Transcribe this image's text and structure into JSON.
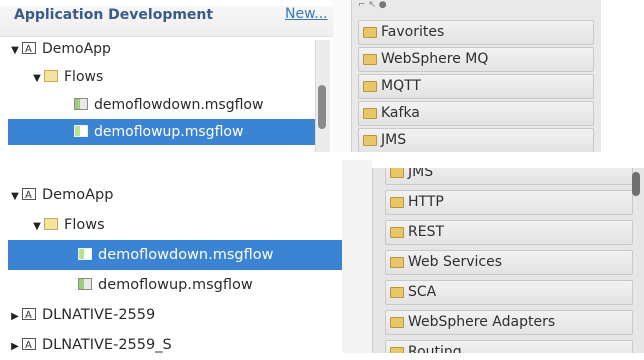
{
  "top_panel": {
    "title": "Application Development",
    "new_link": "New...",
    "tree": [
      {
        "label": "DemoApp",
        "level": 0,
        "expanded": true,
        "icon": "application-icon"
      },
      {
        "label": "Flows",
        "level": 1,
        "expanded": true,
        "icon": "folder-icon"
      },
      {
        "label": "demoflowdown.msgflow",
        "level": 2,
        "icon": "message-flow-icon",
        "selected": false
      },
      {
        "label": "demoflowup.msgflow",
        "level": 2,
        "icon": "message-flow-icon",
        "selected": true
      }
    ],
    "palette": [
      "Favorites",
      "WebSphere MQ",
      "MQTT",
      "Kafka",
      "JMS"
    ]
  },
  "bottom_panel": {
    "tree": [
      {
        "label": "DemoApp",
        "level": 0,
        "expanded": true,
        "icon": "application-icon"
      },
      {
        "label": "Flows",
        "level": 1,
        "expanded": true,
        "icon": "folder-icon"
      },
      {
        "label": "demoflowdown.msgflow",
        "level": 2,
        "icon": "message-flow-icon",
        "selected": true
      },
      {
        "label": "demoflowup.msgflow",
        "level": 2,
        "icon": "message-flow-icon",
        "selected": false
      },
      {
        "label": "DLNATIVE-2559",
        "level": 0,
        "expanded": false,
        "icon": "application-icon"
      },
      {
        "label": "DLNATIVE-2559_S",
        "level": 0,
        "expanded": false,
        "icon": "application-icon"
      }
    ],
    "palette": [
      "JMS",
      "HTTP",
      "REST",
      "Web Services",
      "SCA",
      "WebSphere Adapters",
      "Routing"
    ]
  },
  "colors": {
    "selection": "#3b83d3",
    "header_text": "#3a5b8a",
    "link": "#3b78b6"
  }
}
